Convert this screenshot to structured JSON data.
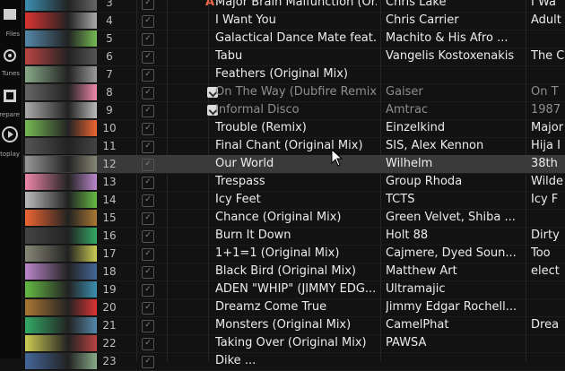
{
  "sidebar": {
    "items": [
      {
        "label": "Files",
        "icon": "folder-icon"
      },
      {
        "label": "Tunes",
        "icon": "tunes-icon"
      },
      {
        "label": "Prepare",
        "icon": "prepare-icon"
      },
      {
        "label": "Autoplay",
        "icon": "play-icon"
      }
    ]
  },
  "tracks": [
    {
      "num": "3",
      "flag": "A",
      "title": "Major Brain Malfunction (Or...",
      "artist": "Chris Lake",
      "album": "I Wa"
    },
    {
      "num": "4",
      "flag": "",
      "title": "I Want You",
      "artist": "Chris Carrier",
      "album": "Adult"
    },
    {
      "num": "5",
      "flag": "",
      "title": "Galactical Dance Mate feat....",
      "artist": "Machito & His Afro ...",
      "album": ""
    },
    {
      "num": "6",
      "flag": "",
      "title": "Tabu",
      "artist": "Vangelis Kostoxenakis",
      "album": "The C"
    },
    {
      "num": "7",
      "flag": "",
      "title": "Feathers (Original Mix)",
      "artist": "",
      "album": ""
    },
    {
      "num": "8",
      "flag": "icon",
      "title": "On The Way (Dubfire Remix)",
      "artist": "Gaiser",
      "album": "On T",
      "dim": true
    },
    {
      "num": "9",
      "flag": "icon",
      "title": "Informal Disco",
      "artist": "Amtrac",
      "album": "1987",
      "dim": true
    },
    {
      "num": "10",
      "flag": "",
      "title": "Trouble (Remix)",
      "artist": "Einzelkind",
      "album": "Major"
    },
    {
      "num": "11",
      "flag": "",
      "title": "Final Chant (Original Mix)",
      "artist": "SIS, Alex Kennon",
      "album": "Hija I"
    },
    {
      "num": "12",
      "flag": "",
      "title": "Our World",
      "artist": "Wilhelm",
      "album": "38th",
      "highlight": true
    },
    {
      "num": "13",
      "flag": "",
      "title": "Trespass",
      "artist": "Group Rhoda",
      "album": "Wilde"
    },
    {
      "num": "14",
      "flag": "",
      "title": "Icy Feet",
      "artist": "TCTS",
      "album": "Icy F"
    },
    {
      "num": "15",
      "flag": "",
      "title": "Chance (Original Mix)",
      "artist": "Green Velvet, Shiba ...",
      "album": ""
    },
    {
      "num": "16",
      "flag": "",
      "title": "Burn It Down",
      "artist": "Holt 88",
      "album": "Dirty"
    },
    {
      "num": "17",
      "flag": "",
      "title": "1+1=1 (Original Mix)",
      "artist": "Cajmere, Dyed Soun...",
      "album": "Too"
    },
    {
      "num": "18",
      "flag": "",
      "title": "Black Bird (Original Mix)",
      "artist": "Matthew Art",
      "album": "elect"
    },
    {
      "num": "19",
      "flag": "",
      "title": "ADEN \"WHIP\" (JIMMY EDG...",
      "artist": "Ultramajic",
      "album": ""
    },
    {
      "num": "20",
      "flag": "",
      "title": "Dreamz Come True",
      "artist": "Jimmy Edgar Rochell...",
      "album": ""
    },
    {
      "num": "21",
      "flag": "",
      "title": "Monsters (Original Mix)",
      "artist": "CamelPhat",
      "album": "Drea"
    },
    {
      "num": "22",
      "flag": "",
      "title": "Taking Over (Original Mix)",
      "artist": "PAWSA",
      "album": ""
    },
    {
      "num": "23",
      "flag": "",
      "title": "Dike ...",
      "artist": "",
      "album": ""
    }
  ],
  "colors": {
    "accent": "#e9674b",
    "highlight_row": "#3a3a3a",
    "background": "#121212"
  }
}
